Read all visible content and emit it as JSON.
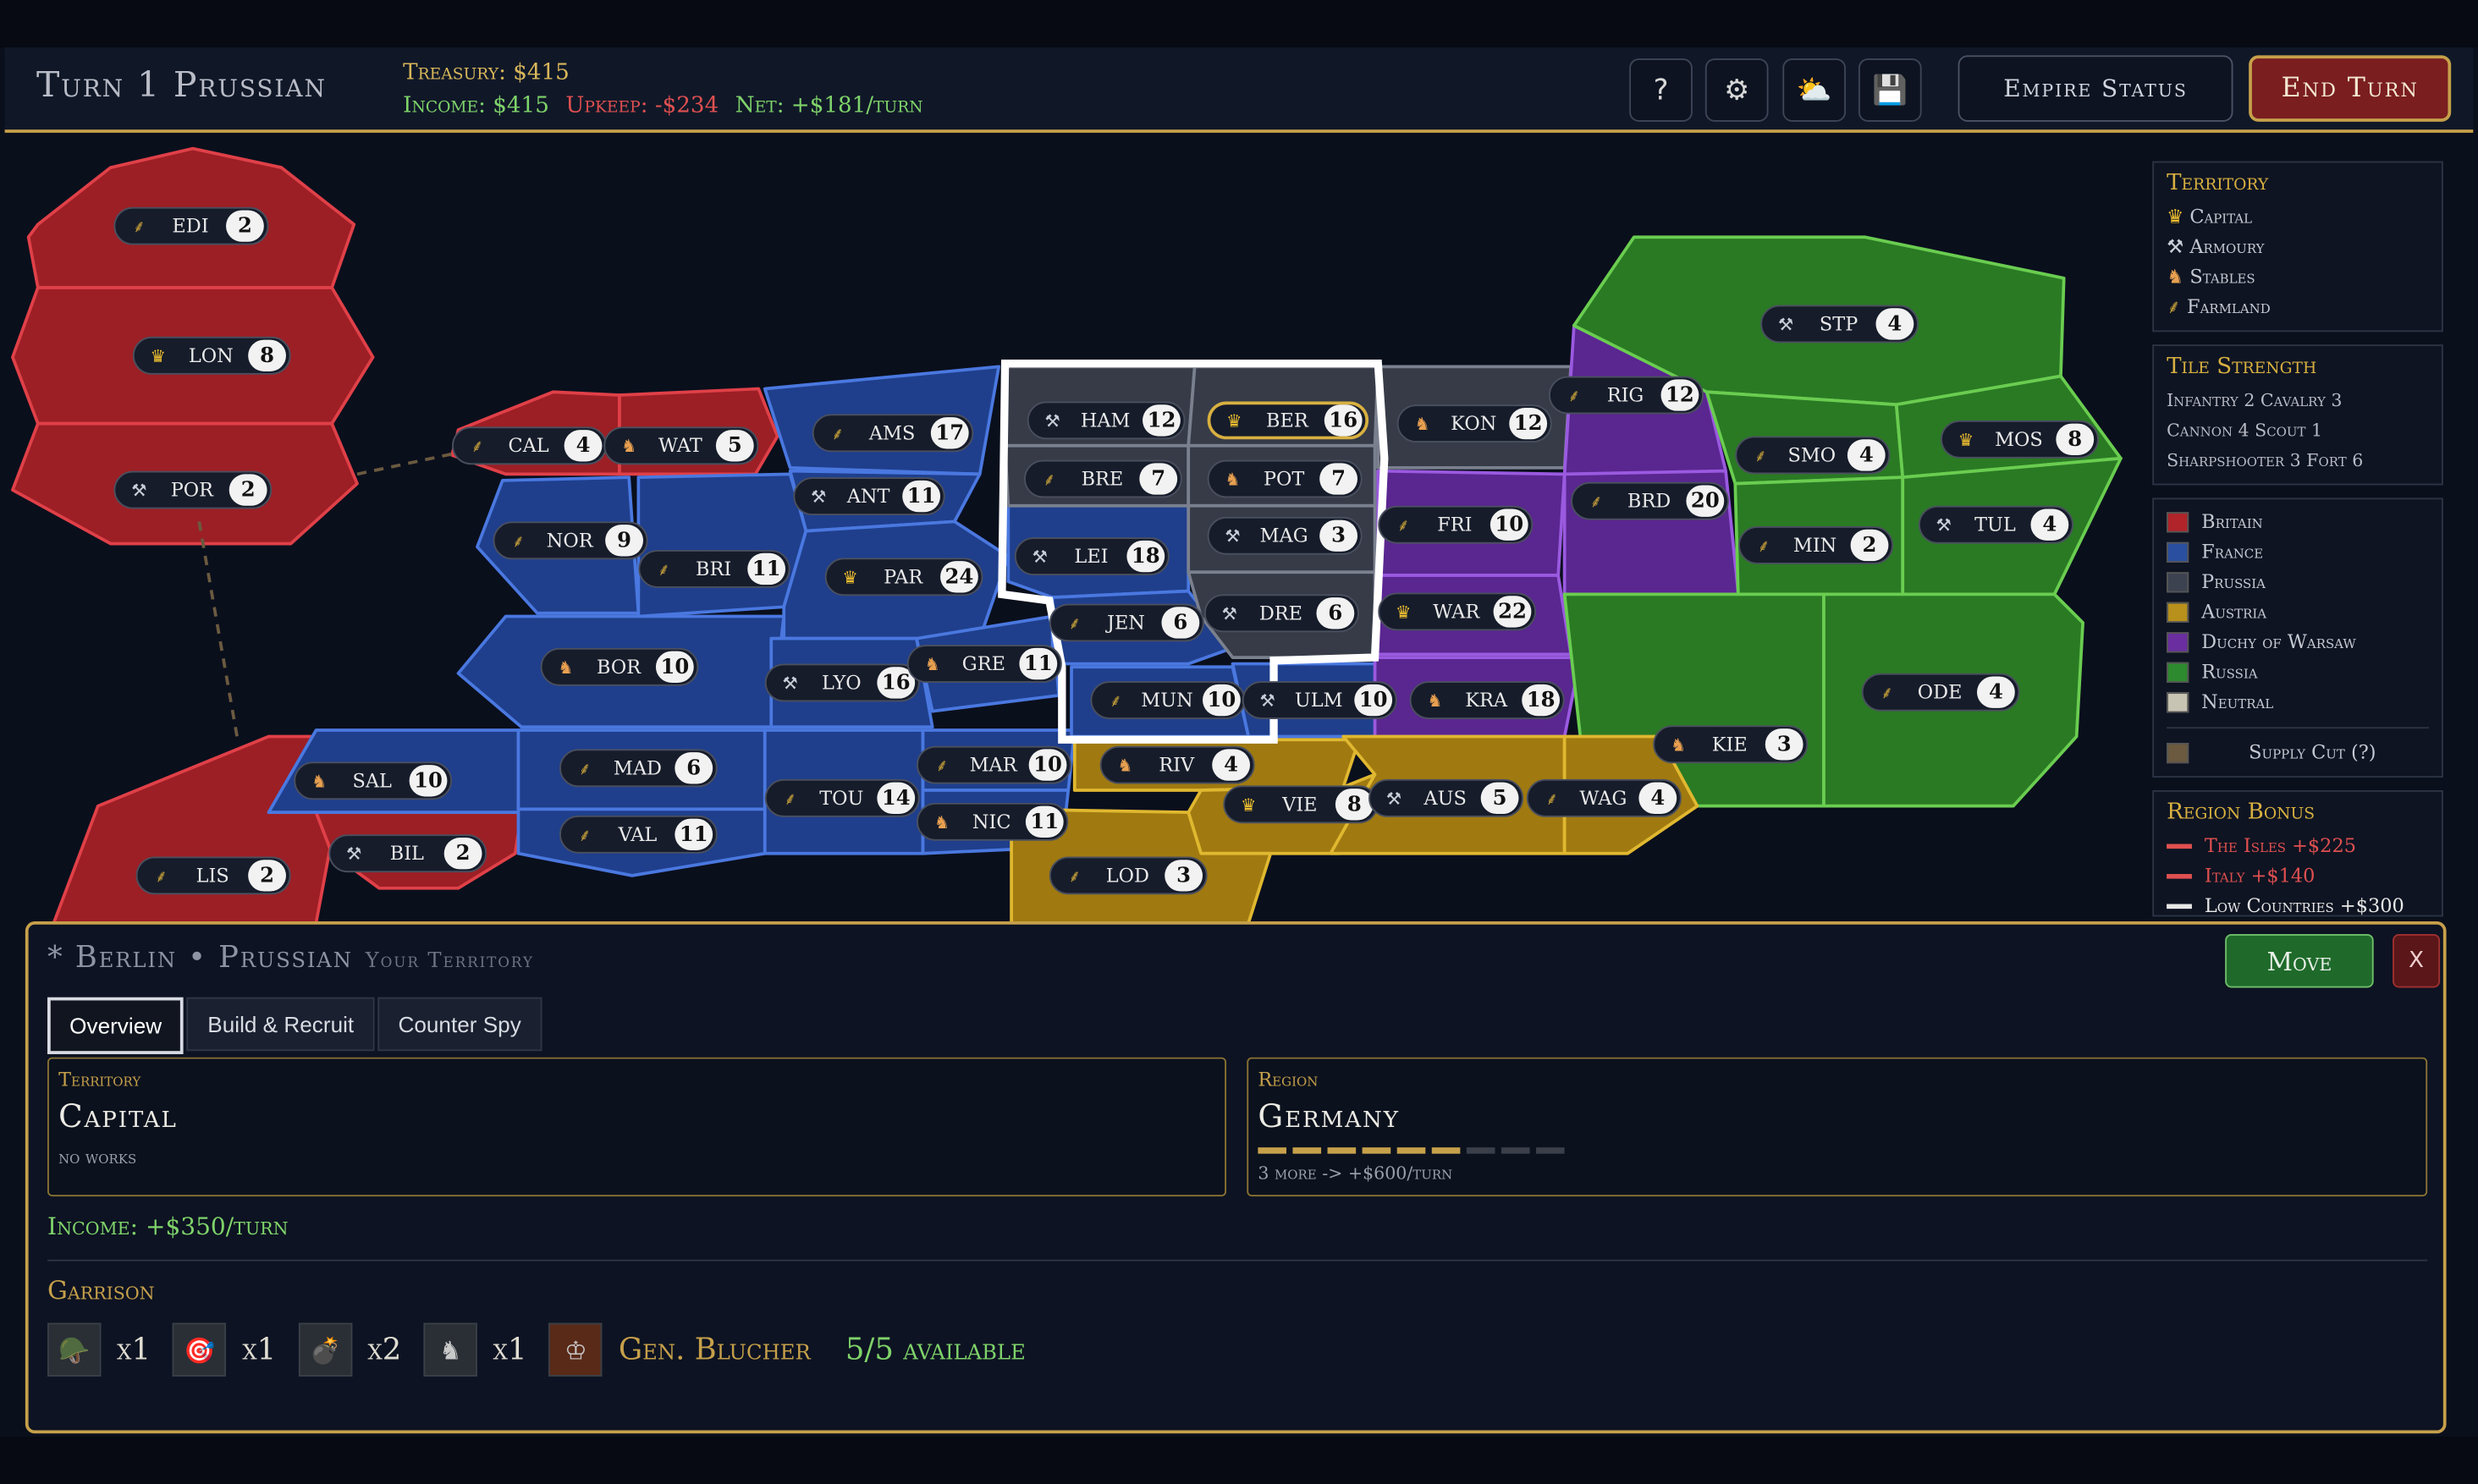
{
  "header": {
    "turn_title": "Turn 1  Prussian",
    "treasury": "Treasury: $415",
    "income": "Income: $415",
    "upkeep": "Upkeep: -$234",
    "net": "Net: +$181/turn",
    "buttons": {
      "help": "?",
      "empire_status": "Empire Status",
      "end_turn": "End Turn"
    }
  },
  "territories": [
    {
      "name": "EDI",
      "count": "2",
      "icon": "farmland-icon",
      "color": "#b0242a"
    },
    {
      "name": "LON",
      "count": "8",
      "icon": "capital-icon",
      "color": "#b0242a"
    },
    {
      "name": "POR",
      "count": "2",
      "icon": "armoury-icon",
      "color": "#b0242a"
    },
    {
      "name": "CAL",
      "count": "4",
      "icon": "farmland-icon",
      "color": "#b0242a"
    },
    {
      "name": "WAT",
      "count": "5",
      "icon": "stables-icon",
      "color": "#b0242a"
    },
    {
      "name": "AMS",
      "count": "17",
      "icon": "farmland-icon",
      "color": "#2a4fa0"
    },
    {
      "name": "ANT",
      "count": "11",
      "icon": "armoury-icon",
      "color": "#2a4fa0"
    },
    {
      "name": "NOR",
      "count": "9",
      "icon": "farmland-icon",
      "color": "#2a4fa0"
    },
    {
      "name": "BRI",
      "count": "11",
      "icon": "farmland-icon",
      "color": "#2a4fa0"
    },
    {
      "name": "PAR",
      "count": "24",
      "icon": "capital-icon",
      "color": "#2a4fa0"
    },
    {
      "name": "BOR",
      "count": "10",
      "icon": "stables-icon",
      "color": "#2a4fa0"
    },
    {
      "name": "LYO",
      "count": "16",
      "icon": "armoury-icon",
      "color": "#2a4fa0"
    },
    {
      "name": "GRE",
      "count": "11",
      "icon": "stables-icon",
      "color": "#2a4fa0"
    },
    {
      "name": "SAL",
      "count": "10",
      "icon": "stables-icon",
      "color": "#2a4fa0"
    },
    {
      "name": "MAD",
      "count": "6",
      "icon": "farmland-icon",
      "color": "#2a4fa0"
    },
    {
      "name": "VAL",
      "count": "11",
      "icon": "farmland-icon",
      "color": "#2a4fa0"
    },
    {
      "name": "BIL",
      "count": "2",
      "icon": "armoury-icon",
      "color": "#b0242a"
    },
    {
      "name": "LIS",
      "count": "2",
      "icon": "farmland-icon",
      "color": "#b0242a"
    },
    {
      "name": "TOU",
      "count": "14",
      "icon": "farmland-icon",
      "color": "#2a4fa0"
    },
    {
      "name": "MAR",
      "count": "10",
      "icon": "farmland-icon",
      "color": "#2a4fa0"
    },
    {
      "name": "NIC",
      "count": "11",
      "icon": "stables-icon",
      "color": "#2a4fa0"
    },
    {
      "name": "HAM",
      "count": "12",
      "icon": "armoury-icon",
      "color": "#3c4250"
    },
    {
      "name": "BER",
      "count": "16",
      "icon": "capital-icon",
      "color": "#3c4250",
      "selected": true
    },
    {
      "name": "BRE",
      "count": "7",
      "icon": "farmland-icon",
      "color": "#3c4250"
    },
    {
      "name": "POT",
      "count": "7",
      "icon": "stables-icon",
      "color": "#3c4250"
    },
    {
      "name": "LEI",
      "count": "18",
      "icon": "armoury-icon",
      "color": "#2a4fa0"
    },
    {
      "name": "MAG",
      "count": "3",
      "icon": "armoury-icon",
      "color": "#3c4250"
    },
    {
      "name": "JEN",
      "count": "6",
      "icon": "farmland-icon",
      "color": "#2a4fa0"
    },
    {
      "name": "DRE",
      "count": "6",
      "icon": "armoury-icon",
      "color": "#3c4250"
    },
    {
      "name": "MUN",
      "count": "10",
      "icon": "farmland-icon",
      "color": "#2a4fa0"
    },
    {
      "name": "ULM",
      "count": "10",
      "icon": "armoury-icon",
      "color": "#2a4fa0"
    },
    {
      "name": "KON",
      "count": "12",
      "icon": "stables-icon",
      "color": "#3c4250"
    },
    {
      "name": "RIG",
      "count": "12",
      "icon": "farmland-icon",
      "color": "#6a2ea0"
    },
    {
      "name": "FRI",
      "count": "10",
      "icon": "farmland-icon",
      "color": "#6a2ea0"
    },
    {
      "name": "BRD",
      "count": "20",
      "icon": "farmland-icon",
      "color": "#6a2ea0"
    },
    {
      "name": "WAR",
      "count": "22",
      "icon": "capital-icon",
      "color": "#6a2ea0"
    },
    {
      "name": "KRA",
      "count": "18",
      "icon": "stables-icon",
      "color": "#6a2ea0"
    },
    {
      "name": "STP",
      "count": "4",
      "icon": "armoury-icon",
      "color": "#2e8a2e"
    },
    {
      "name": "SMO",
      "count": "4",
      "icon": "farmland-icon",
      "color": "#2e8a2e"
    },
    {
      "name": "MOS",
      "count": "8",
      "icon": "capital-icon",
      "color": "#2e8a2e"
    },
    {
      "name": "MIN",
      "count": "2",
      "icon": "farmland-icon",
      "color": "#2e8a2e"
    },
    {
      "name": "TUL",
      "count": "4",
      "icon": "armoury-icon",
      "color": "#2e8a2e"
    },
    {
      "name": "ODE",
      "count": "4",
      "icon": "farmland-icon",
      "color": "#2e8a2e"
    },
    {
      "name": "KIE",
      "count": "3",
      "icon": "stables-icon",
      "color": "#2e8a2e"
    },
    {
      "name": "RIV",
      "count": "4",
      "icon": "stables-icon",
      "color": "#b8901c"
    },
    {
      "name": "VIE",
      "count": "8",
      "icon": "capital-icon",
      "color": "#b8901c"
    },
    {
      "name": "AUS",
      "count": "5",
      "icon": "armoury-icon",
      "color": "#b8901c"
    },
    {
      "name": "WAG",
      "count": "4",
      "icon": "farmland-icon",
      "color": "#b8901c"
    },
    {
      "name": "LOD",
      "count": "3",
      "icon": "farmland-icon",
      "color": "#b8901c"
    }
  ],
  "legend": {
    "territory_title": "Territory",
    "types": [
      {
        "label": "Capital",
        "icon": "capital-icon"
      },
      {
        "label": "Armoury",
        "icon": "armoury-icon"
      },
      {
        "label": "Stables",
        "icon": "stables-icon"
      },
      {
        "label": "Farmland",
        "icon": "farmland-icon"
      }
    ],
    "strength_title": "Tile Strength",
    "strength_rows": [
      "Infantry 2   Cavalry 3",
      "Cannon 4   Scout 1",
      "Sharpshooter 3   Fort 6"
    ],
    "nations": [
      {
        "label": "Britain",
        "color": "#b0242a"
      },
      {
        "label": "France",
        "color": "#2a4fa0"
      },
      {
        "label": "Prussia",
        "color": "#3c4250"
      },
      {
        "label": "Austria",
        "color": "#b8901c"
      },
      {
        "label": "Duchy of Warsaw",
        "color": "#6a2ea0"
      },
      {
        "label": "Russia",
        "color": "#2e8a2e"
      },
      {
        "label": "Neutral",
        "color": "#c8c4b4"
      }
    ],
    "supply_cut": "Supply Cut  (?)",
    "supply_color": "#6b5a40",
    "region_title": "Region Bonus",
    "regions": [
      {
        "label": "The Isles  +$225",
        "color": "#e05050"
      },
      {
        "label": "Italy  +$140",
        "color": "#e05050"
      },
      {
        "label": "Low Countries  +$300",
        "color": "#e8e8e8"
      }
    ]
  },
  "panel": {
    "title": "* Berlin  •  Prussian",
    "subtitle": "Your Territory",
    "move": "Move",
    "close": "X",
    "tabs": [
      "Overview",
      "Build & Recruit",
      "Counter Spy"
    ],
    "territory_label": "Territory",
    "territory_value": "Capital",
    "territory_works": "no works",
    "region_label": "Region",
    "region_value": "Germany",
    "region_progress": {
      "filled": 6,
      "total": 9
    },
    "region_bonus": "3 more -> +$600/turn",
    "income": "Income: +$350/turn",
    "garrison_title": "Garrison",
    "garrison": [
      {
        "icon": "infantry-icon",
        "count": "x1"
      },
      {
        "icon": "sharpshooter-icon",
        "count": "x1"
      },
      {
        "icon": "cannon-icon",
        "count": "x2"
      },
      {
        "icon": "cavalry-icon",
        "count": "x1"
      }
    ],
    "general": "Gen. Blucher",
    "available": "5/5 available"
  }
}
